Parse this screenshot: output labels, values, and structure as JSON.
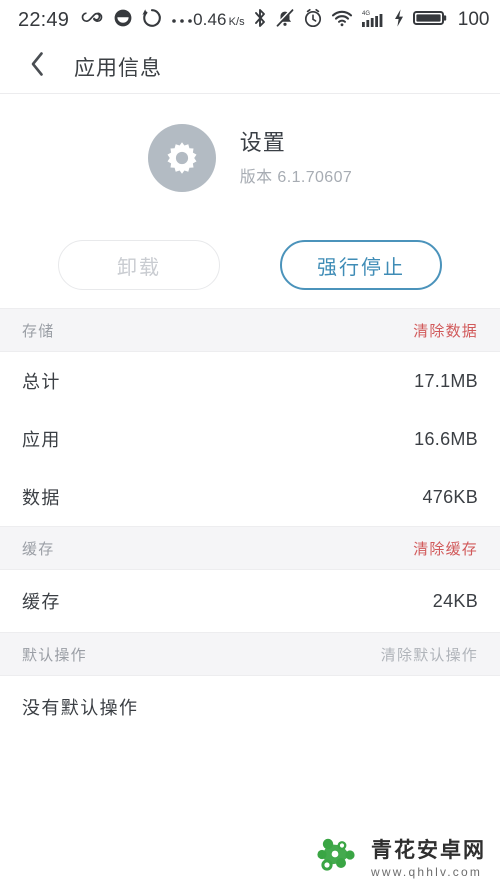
{
  "status_bar": {
    "time": "22:49",
    "data_rate": "0.46",
    "data_rate_unit_top": "K",
    "data_rate_unit_bottom": "s",
    "battery_percent": "100",
    "network_label": "4G",
    "icons": [
      "infinity-icon",
      "smiley-icon",
      "sync-icon",
      "more-dots-icon",
      "bluetooth-icon",
      "mute-icon",
      "alarm-icon",
      "wifi-icon",
      "signal-bars-icon",
      "charging-bolt-icon",
      "battery-icon"
    ]
  },
  "titlebar": {
    "back_icon": "chevron-left-icon",
    "title": "应用信息"
  },
  "app": {
    "icon": "gear-icon",
    "name": "设置",
    "version": "版本 6.1.70607"
  },
  "actions": {
    "uninstall_label": "卸载",
    "force_stop_label": "强行停止"
  },
  "sections": [
    {
      "title": "存储",
      "action_label": "清除数据",
      "action_style": "danger",
      "rows": [
        {
          "label": "总计",
          "value": "17.1MB"
        },
        {
          "label": "应用",
          "value": "16.6MB"
        },
        {
          "label": "数据",
          "value": "476KB"
        }
      ]
    },
    {
      "title": "缓存",
      "action_label": "清除缓存",
      "action_style": "danger",
      "rows": [
        {
          "label": "缓存",
          "value": "24KB"
        }
      ]
    },
    {
      "title": "默认操作",
      "action_label": "清除默认操作",
      "action_style": "muted",
      "rows": [
        {
          "label": "没有默认操作",
          "value": ""
        }
      ]
    }
  ],
  "watermark": {
    "name": "青花安卓网",
    "url": "www.qhhlv.com",
    "logo_color": "#3aa544"
  },
  "colors": {
    "accent_blue": "#3f8cb6",
    "danger_red": "#d1595a",
    "muted_gray": "#b0b4ba",
    "section_bg": "#f5f5f7",
    "app_icon_bg": "#b3bbc3"
  }
}
